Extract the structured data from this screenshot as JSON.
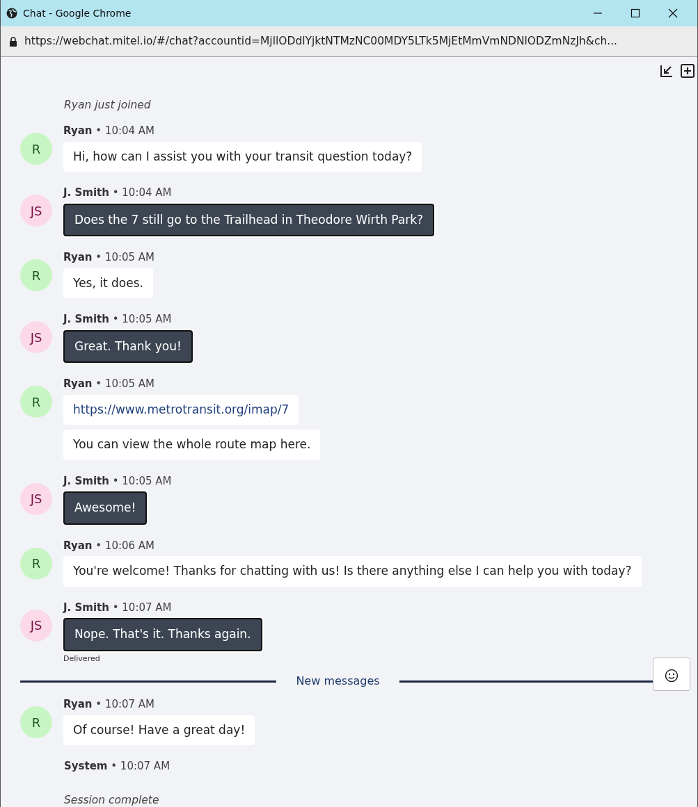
{
  "window": {
    "title": "Chat - Google Chrome",
    "url": "https://webchat.mitel.io/#/chat?accountid=MjllODdlYjktNTMzNC00MDY5LTk5MjEtMmVmNDNlODZmNzJh&ch..."
  },
  "items": [
    {
      "kind": "note",
      "text": "Ryan just joined"
    },
    {
      "kind": "message",
      "outgoing": false,
      "avatar": "R",
      "meta": "**Ryan** • 10:04 AM",
      "bubbles": [
        {
          "kind": "text",
          "text": "Hi, how can I assist you with your transit question today?"
        }
      ]
    },
    {
      "kind": "message",
      "outgoing": true,
      "avatar": "JS",
      "meta": "**J. Smith** • 10:04 AM",
      "bubbles": [
        {
          "kind": "text",
          "text": "Does the 7 still go to the Trailhead in Theodore Wirth Park?"
        }
      ]
    },
    {
      "kind": "message",
      "outgoing": false,
      "avatar": "R",
      "meta": "**Ryan** • 10:05 AM",
      "bubbles": [
        {
          "kind": "text",
          "text": "Yes, it does."
        }
      ]
    },
    {
      "kind": "message",
      "outgoing": true,
      "avatar": "JS",
      "meta": "**J. Smith** • 10:05 AM",
      "bubbles": [
        {
          "kind": "text",
          "text": "Great. Thank you!"
        }
      ]
    },
    {
      "kind": "message",
      "outgoing": false,
      "avatar": "R",
      "meta": "**Ryan** • 10:05 AM",
      "bubbles": [
        {
          "kind": "link",
          "text": "https://www.metrotransit.org/imap/7"
        },
        {
          "kind": "text",
          "text": "You can view the whole route map here."
        }
      ]
    },
    {
      "kind": "message",
      "outgoing": true,
      "avatar": "JS",
      "meta": "**J. Smith** • 10:05 AM",
      "bubbles": [
        {
          "kind": "text",
          "text": "Awesome!"
        }
      ]
    },
    {
      "kind": "message",
      "outgoing": false,
      "avatar": "R",
      "meta": "**Ryan** • 10:06 AM",
      "bubbles": [
        {
          "kind": "text",
          "text": "You're welcome! Thanks for chatting with us! Is there anything else I can help you with today?"
        }
      ]
    },
    {
      "kind": "message",
      "outgoing": true,
      "avatar": "JS",
      "meta": "**J. Smith** • 10:07 AM",
      "status": "Delivered",
      "bubbles": [
        {
          "kind": "text",
          "text": "Nope. That's it. Thanks again."
        }
      ]
    },
    {
      "kind": "divider",
      "text": "New messages"
    },
    {
      "kind": "message",
      "outgoing": false,
      "avatar": "R",
      "meta": "**Ryan** • 10:07 AM",
      "bubbles": [
        {
          "kind": "text",
          "text": "Of course! Have a great day!"
        }
      ]
    },
    {
      "kind": "message",
      "meta": "**System** • 10:07 AM"
    },
    {
      "kind": "note",
      "text": "Session complete"
    }
  ]
}
